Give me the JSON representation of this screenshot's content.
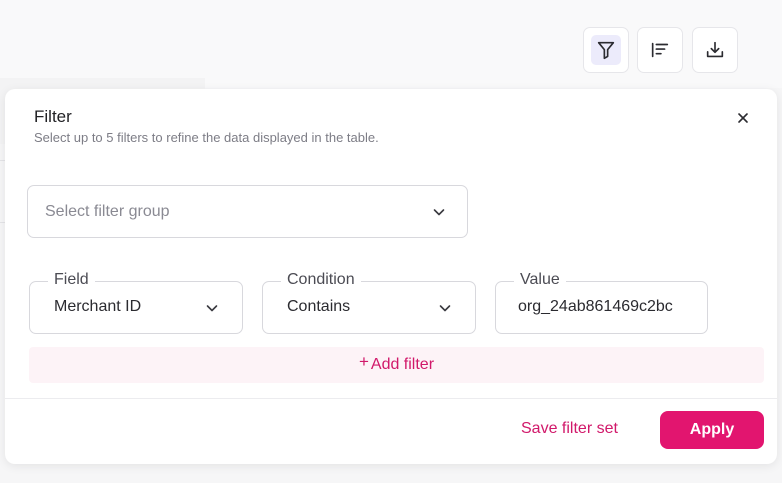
{
  "toolbar": {
    "filter_icon": "funnel-icon",
    "sort_icon": "sort-lines-icon",
    "download_icon": "download-icon"
  },
  "panel": {
    "title": "Filter",
    "subtitle": "Select up to 5 filters to refine the data displayed in the table.",
    "close_icon": "close-icon",
    "filter_group_placeholder": "Select filter group",
    "field_label": "Field",
    "field_value": "Merchant ID",
    "condition_label": "Condition",
    "condition_value": "Contains",
    "value_label": "Value",
    "value_value": "org_24ab861469c2bc",
    "add_filter_label": "Add filter",
    "add_filter_plus": "+",
    "save_filter_set": "Save filter set",
    "apply": "Apply"
  },
  "colors": {
    "accent": "#e2156f",
    "accent_text": "#d1186a",
    "add_filter_bg": "#fdf3f7",
    "active_icon_bg": "#ecebfb"
  }
}
